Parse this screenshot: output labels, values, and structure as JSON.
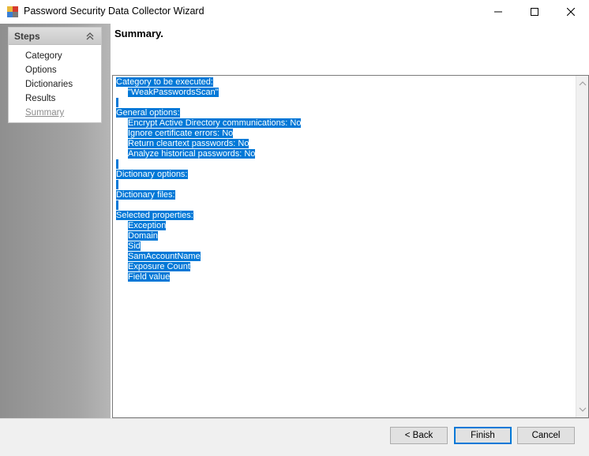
{
  "window": {
    "title": "Password Security Data Collector Wizard"
  },
  "steps": {
    "title": "Steps",
    "items": [
      {
        "label": "Category"
      },
      {
        "label": "Options"
      },
      {
        "label": "Dictionaries"
      },
      {
        "label": "Results"
      },
      {
        "label": "Summary",
        "current": true
      }
    ]
  },
  "page": {
    "title": "Summary."
  },
  "summary": {
    "lines": [
      "Category to be executed:",
      "\"WeakPasswordsScan\"",
      "",
      "General options:",
      "Encrypt Active Directory communications: No",
      "Ignore certificate errors: No",
      "Return cleartext passwords: No",
      "Analyze historical passwords: No",
      "",
      "Dictionary options:",
      "",
      "Dictionary files:",
      "",
      "Selected properties:",
      "Exception",
      "Domain",
      "Sid",
      "SamAccountName",
      "Exposure Count",
      "Field value"
    ],
    "selection_color": "#0078d7"
  },
  "buttons": {
    "back": "< Back",
    "finish": "Finish",
    "cancel": "Cancel"
  }
}
